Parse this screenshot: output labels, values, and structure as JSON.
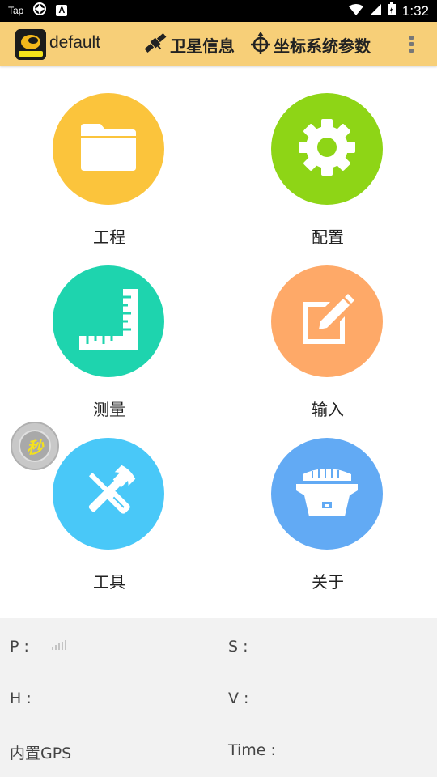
{
  "status_bar": {
    "app_label": "Tap",
    "notif_letter": "A",
    "time": "1:32"
  },
  "app_bar": {
    "title": "default",
    "actions": [
      {
        "label": "卫星信息",
        "icon": "satellite-icon"
      },
      {
        "label": "坐标系统参数",
        "icon": "crosshair-icon"
      }
    ],
    "overflow_icon": "more-vert-icon",
    "background": "#f7cf78"
  },
  "tiles": [
    {
      "label": "工程",
      "icon": "folder-icon",
      "color": "#fbc43c"
    },
    {
      "label": "配置",
      "icon": "gear-icon",
      "color": "#8ed516"
    },
    {
      "label": "测量",
      "icon": "ruler-icon",
      "color": "#1ed4ae"
    },
    {
      "label": "输入",
      "icon": "edit-icon",
      "color": "#fea968"
    },
    {
      "label": "工具",
      "icon": "tools-icon",
      "color": "#49c8f8"
    },
    {
      "label": "关于",
      "icon": "gnss-receiver-icon",
      "color": "#62aaf4"
    }
  ],
  "float_button": {
    "label": "秒"
  },
  "info": {
    "p_label": "P :",
    "s_label": "S :",
    "h_label": "H :",
    "v_label": "V :",
    "gps_label": "内置GPS",
    "time_label": "Time :"
  }
}
